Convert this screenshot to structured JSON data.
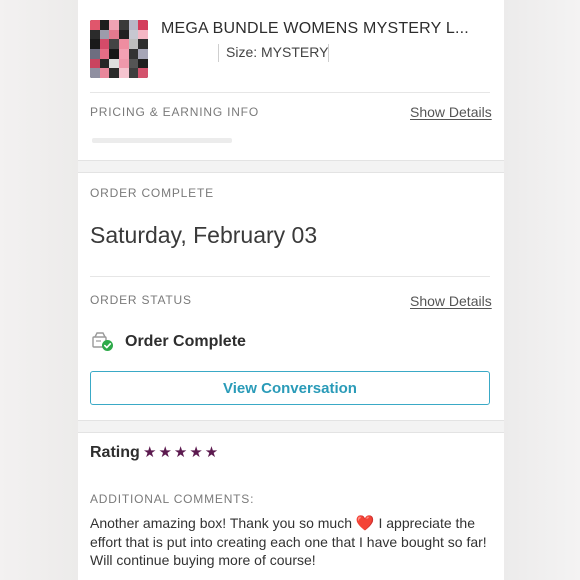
{
  "product": {
    "title": "MEGA BUNDLE WOMENS MYSTERY L...",
    "size_label": "Size: MYSTERY",
    "thumbnail_colors": [
      "#e0566c",
      "#1d1d1d",
      "#f0a3b4",
      "#3a3a3a",
      "#b8b8c8",
      "#d43c5b",
      "#2b2b2b",
      "#9c9cab",
      "#e37a8f",
      "#202020",
      "#c7c7d0",
      "#f4b7c4",
      "#1a1a1a",
      "#d44b69",
      "#444",
      "#ee8da0",
      "#bdbdbd",
      "#2e2e2e",
      "#6e6e80",
      "#e56d86",
      "#181818",
      "#f3a0b3",
      "#333",
      "#a6a6b6",
      "#c9445f",
      "#262626",
      "#dedede",
      "#ef98ab",
      "#555",
      "#1f1f1f",
      "#8f8fa0",
      "#e8879b",
      "#2a2a2a",
      "#f5c4cf",
      "#3e3e3e",
      "#d3536d"
    ]
  },
  "pricing": {
    "heading": "PRICING & EARNING INFO",
    "show_details": "Show Details"
  },
  "order_complete": {
    "heading": "ORDER COMPLETE",
    "date": "Saturday, February 03"
  },
  "order_status": {
    "heading": "ORDER STATUS",
    "show_details": "Show Details",
    "status_text": "Order Complete",
    "button_label": "View Conversation",
    "icon": "order-complete-icon"
  },
  "rating": {
    "label": "Rating",
    "stars": "★★★★★",
    "value": 5,
    "max": 5,
    "color": "#5c1a4f"
  },
  "comments": {
    "heading": "ADDITIONAL COMMENTS:",
    "text_before_heart": "Another amazing box! Thank you so much",
    "heart": "❤️",
    "text_after_heart": "I appreciate the effort that is put into creating each one that I have bought so far! Will continue buying more of course!"
  },
  "colors": {
    "accent": "#2a9bb8",
    "success": "#2eaa4a"
  }
}
